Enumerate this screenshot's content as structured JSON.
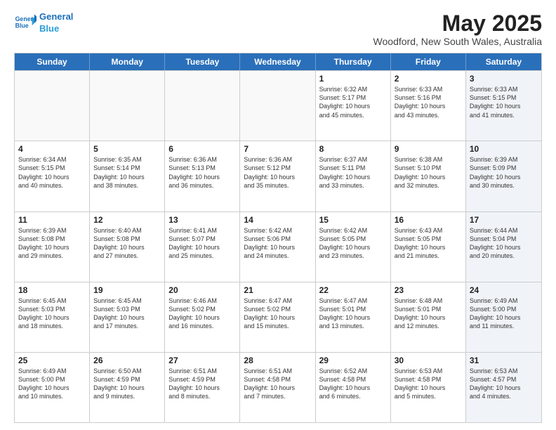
{
  "header": {
    "logo_line1": "General",
    "logo_line2": "Blue",
    "month_title": "May 2025",
    "location": "Woodford, New South Wales, Australia"
  },
  "weekdays": [
    "Sunday",
    "Monday",
    "Tuesday",
    "Wednesday",
    "Thursday",
    "Friday",
    "Saturday"
  ],
  "rows": [
    [
      {
        "day": "",
        "info": "",
        "empty": true
      },
      {
        "day": "",
        "info": "",
        "empty": true
      },
      {
        "day": "",
        "info": "",
        "empty": true
      },
      {
        "day": "",
        "info": "",
        "empty": true
      },
      {
        "day": "1",
        "info": "Sunrise: 6:32 AM\nSunset: 5:17 PM\nDaylight: 10 hours\nand 45 minutes."
      },
      {
        "day": "2",
        "info": "Sunrise: 6:33 AM\nSunset: 5:16 PM\nDaylight: 10 hours\nand 43 minutes."
      },
      {
        "day": "3",
        "info": "Sunrise: 6:33 AM\nSunset: 5:15 PM\nDaylight: 10 hours\nand 41 minutes.",
        "saturday": true
      }
    ],
    [
      {
        "day": "4",
        "info": "Sunrise: 6:34 AM\nSunset: 5:15 PM\nDaylight: 10 hours\nand 40 minutes."
      },
      {
        "day": "5",
        "info": "Sunrise: 6:35 AM\nSunset: 5:14 PM\nDaylight: 10 hours\nand 38 minutes."
      },
      {
        "day": "6",
        "info": "Sunrise: 6:36 AM\nSunset: 5:13 PM\nDaylight: 10 hours\nand 36 minutes."
      },
      {
        "day": "7",
        "info": "Sunrise: 6:36 AM\nSunset: 5:12 PM\nDaylight: 10 hours\nand 35 minutes."
      },
      {
        "day": "8",
        "info": "Sunrise: 6:37 AM\nSunset: 5:11 PM\nDaylight: 10 hours\nand 33 minutes."
      },
      {
        "day": "9",
        "info": "Sunrise: 6:38 AM\nSunset: 5:10 PM\nDaylight: 10 hours\nand 32 minutes."
      },
      {
        "day": "10",
        "info": "Sunrise: 6:39 AM\nSunset: 5:09 PM\nDaylight: 10 hours\nand 30 minutes.",
        "saturday": true
      }
    ],
    [
      {
        "day": "11",
        "info": "Sunrise: 6:39 AM\nSunset: 5:08 PM\nDaylight: 10 hours\nand 29 minutes."
      },
      {
        "day": "12",
        "info": "Sunrise: 6:40 AM\nSunset: 5:08 PM\nDaylight: 10 hours\nand 27 minutes."
      },
      {
        "day": "13",
        "info": "Sunrise: 6:41 AM\nSunset: 5:07 PM\nDaylight: 10 hours\nand 25 minutes."
      },
      {
        "day": "14",
        "info": "Sunrise: 6:42 AM\nSunset: 5:06 PM\nDaylight: 10 hours\nand 24 minutes."
      },
      {
        "day": "15",
        "info": "Sunrise: 6:42 AM\nSunset: 5:05 PM\nDaylight: 10 hours\nand 23 minutes."
      },
      {
        "day": "16",
        "info": "Sunrise: 6:43 AM\nSunset: 5:05 PM\nDaylight: 10 hours\nand 21 minutes."
      },
      {
        "day": "17",
        "info": "Sunrise: 6:44 AM\nSunset: 5:04 PM\nDaylight: 10 hours\nand 20 minutes.",
        "saturday": true
      }
    ],
    [
      {
        "day": "18",
        "info": "Sunrise: 6:45 AM\nSunset: 5:03 PM\nDaylight: 10 hours\nand 18 minutes."
      },
      {
        "day": "19",
        "info": "Sunrise: 6:45 AM\nSunset: 5:03 PM\nDaylight: 10 hours\nand 17 minutes."
      },
      {
        "day": "20",
        "info": "Sunrise: 6:46 AM\nSunset: 5:02 PM\nDaylight: 10 hours\nand 16 minutes."
      },
      {
        "day": "21",
        "info": "Sunrise: 6:47 AM\nSunset: 5:02 PM\nDaylight: 10 hours\nand 15 minutes."
      },
      {
        "day": "22",
        "info": "Sunrise: 6:47 AM\nSunset: 5:01 PM\nDaylight: 10 hours\nand 13 minutes."
      },
      {
        "day": "23",
        "info": "Sunrise: 6:48 AM\nSunset: 5:01 PM\nDaylight: 10 hours\nand 12 minutes."
      },
      {
        "day": "24",
        "info": "Sunrise: 6:49 AM\nSunset: 5:00 PM\nDaylight: 10 hours\nand 11 minutes.",
        "saturday": true
      }
    ],
    [
      {
        "day": "25",
        "info": "Sunrise: 6:49 AM\nSunset: 5:00 PM\nDaylight: 10 hours\nand 10 minutes."
      },
      {
        "day": "26",
        "info": "Sunrise: 6:50 AM\nSunset: 4:59 PM\nDaylight: 10 hours\nand 9 minutes."
      },
      {
        "day": "27",
        "info": "Sunrise: 6:51 AM\nSunset: 4:59 PM\nDaylight: 10 hours\nand 8 minutes."
      },
      {
        "day": "28",
        "info": "Sunrise: 6:51 AM\nSunset: 4:58 PM\nDaylight: 10 hours\nand 7 minutes."
      },
      {
        "day": "29",
        "info": "Sunrise: 6:52 AM\nSunset: 4:58 PM\nDaylight: 10 hours\nand 6 minutes."
      },
      {
        "day": "30",
        "info": "Sunrise: 6:53 AM\nSunset: 4:58 PM\nDaylight: 10 hours\nand 5 minutes."
      },
      {
        "day": "31",
        "info": "Sunrise: 6:53 AM\nSunset: 4:57 PM\nDaylight: 10 hours\nand 4 minutes.",
        "saturday": true
      }
    ]
  ]
}
